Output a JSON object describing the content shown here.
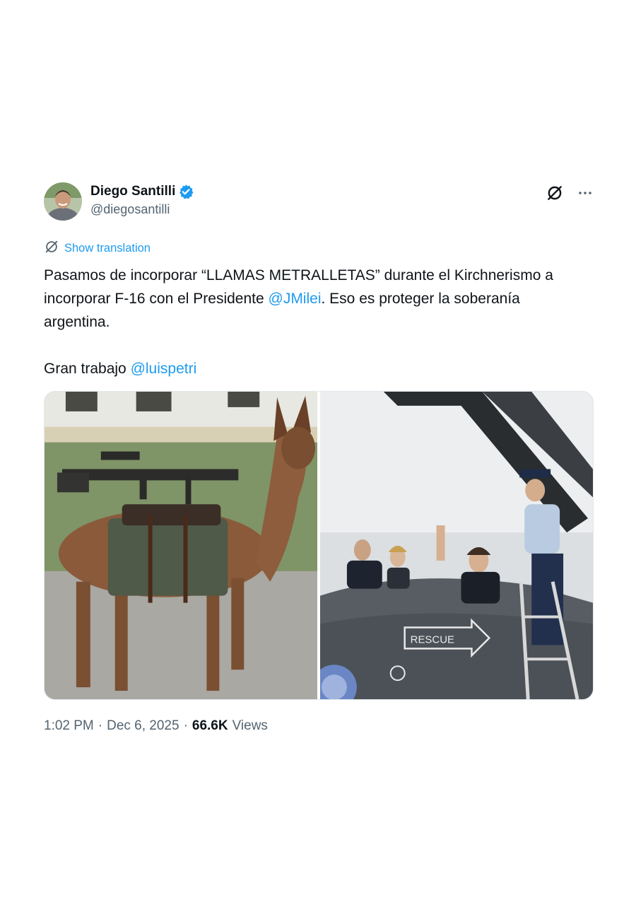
{
  "author": {
    "display_name": "Diego Santilli",
    "handle": "@diegosantilli",
    "verified": true
  },
  "translation": {
    "label": "Show translation"
  },
  "tweet": {
    "line1": "Pasamos de incorporar “LLAMAS METRALLETAS” durante el Kirchnerismo a incorporar F-16 con el Presidente ",
    "mention1": "@JMilei",
    "line1_end": ". Eso es proteger la soberanía argentina.",
    "line2": "Gran trabajo ",
    "mention2": "@luispetri"
  },
  "media": {
    "image_left": "llama-with-machine-gun-photo",
    "image_right": "f16-cockpit-photo",
    "rescue_label": "RESCUE"
  },
  "meta": {
    "time": "1:02 PM",
    "separator": "·",
    "date": "Dec 6, 2025",
    "views_count": "66.6K",
    "views_label": "Views"
  },
  "colors": {
    "accent": "#1d9bf0",
    "text_primary": "#0f1419",
    "text_secondary": "#536471"
  }
}
